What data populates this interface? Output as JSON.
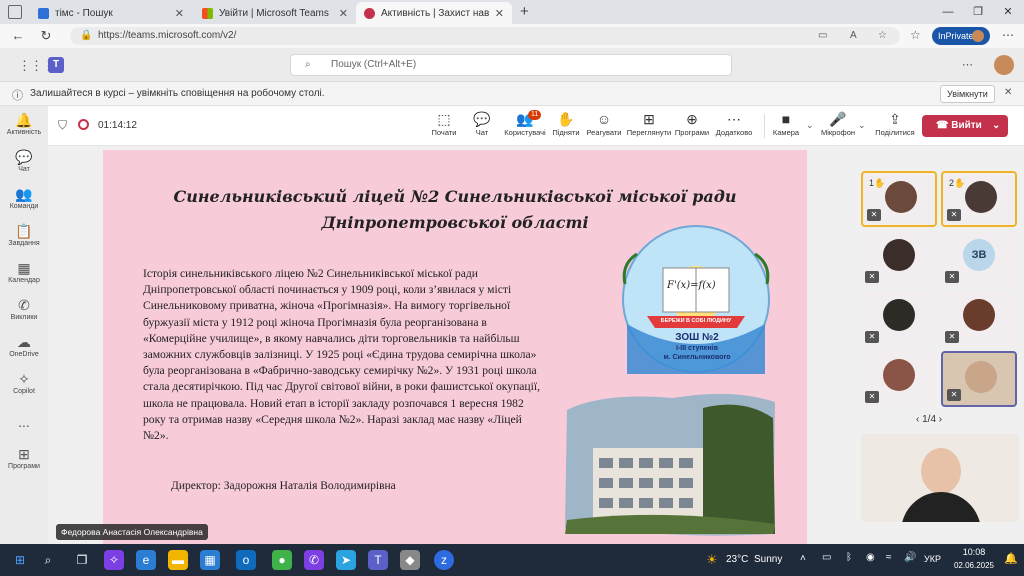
{
  "browser": {
    "tabs": [
      {
        "label": "тімс - Пошук",
        "favicon_color": "#2f6fd8"
      },
      {
        "label": "Увійти | Microsoft Teams",
        "favicon_color": "#e0442d"
      },
      {
        "label": "Активність | Захист навчальн",
        "favicon_color": "#c4314b"
      }
    ],
    "new_tab_icon": "plus-icon",
    "url": "https://teams.microsoft.com/v2/",
    "inprivate_label": "InPrivate"
  },
  "teams": {
    "search_placeholder": "Пошук (Ctrl+Alt+E)",
    "notification": {
      "text": "Залишайтеся в курсі – увімкніть сповіщення на робочому столі.",
      "button": "Увімкнути"
    },
    "rail": [
      {
        "label": "Активність",
        "icon": "bell-icon"
      },
      {
        "label": "Чат",
        "icon": "chat-icon"
      },
      {
        "label": "Команди",
        "icon": "teams-icon"
      },
      {
        "label": "Завдання",
        "icon": "assignments-icon"
      },
      {
        "label": "Календар",
        "icon": "calendar-icon"
      },
      {
        "label": "Виклики",
        "icon": "phone-icon"
      },
      {
        "label": "OneDrive",
        "icon": "cloud-icon"
      },
      {
        "label": "Copilot",
        "icon": "copilot-icon"
      },
      {
        "label": "...",
        "icon": "more-icon"
      },
      {
        "label": "Програми",
        "icon": "apps-icon"
      }
    ],
    "meeting": {
      "timer": "01:14:12",
      "tools": [
        {
          "label": "Почати",
          "icon": "share-icon"
        },
        {
          "label": "Чат",
          "icon": "chat-icon"
        },
        {
          "label": "Користувачі",
          "icon": "people-icon",
          "badge": "11"
        },
        {
          "label": "Підняти",
          "icon": "hand-icon"
        },
        {
          "label": "Реагувати",
          "icon": "smile-icon"
        },
        {
          "label": "Переглянути",
          "icon": "view-icon"
        },
        {
          "label": "Програми",
          "icon": "apps-icon"
        },
        {
          "label": "Додатково",
          "icon": "more-icon"
        }
      ],
      "media": [
        {
          "label": "Камера",
          "icon": "camera-icon"
        },
        {
          "label": "Мікрофон",
          "icon": "microphone-icon"
        },
        {
          "label": "Поділитися",
          "icon": "share-screen-icon"
        }
      ],
      "leave_label": "Вийти",
      "presenter_name": "Федорова Анастасія Олександрівна",
      "pager": "1/4",
      "raised_hands": [
        "1",
        "2"
      ],
      "participant_initials": "ЗВ"
    }
  },
  "slide": {
    "title": "Синельниківський ліцей №2 Синельниківської міської ради Дніпропетровської області",
    "body": "Історія синельниківського ліцею №2 Синельниківської міської ради Дніпропетровської області починається у 1909 році, коли з’явилася у місті Синельниковому приватна, жіноча «Прогімназія». На вимогу торгівельної буржуазії міста у 1912 році жіноча Прогімназія була реорганізована в «Комерційне училище», в якому навчались діти торговельників та найбільш заможних службовців залізниці. У 1925 році «Єдина трудова семирічна школа» була реорганізована в «Фабрично-заводську семирічку №2». У 1931 році школа стала десятирічкою. Під час Другої світової війни, в роки фашистської окупації, школа не працювала. Новий етап в історії закладу розпочався 1 вересня 1982 року та отримав назву «Середня школа №2». Наразі заклад має назву «Ліцей №2».",
    "director": "Директор: Задорожня Наталія Володимирівна",
    "logo": {
      "formula": "F'(x)=f(x)",
      "ribbon": "БЕРЕЖИ В СОБІ ЛЮДИНУ",
      "school": "ЗОШ №2",
      "level": "І-ІІІ ступенів",
      "city": "м. Синельникового"
    }
  },
  "taskbar": {
    "weather_temp": "23°C",
    "weather_text": "Sunny",
    "language": "УКР",
    "time": "10:08",
    "date": "02.06.2025"
  }
}
